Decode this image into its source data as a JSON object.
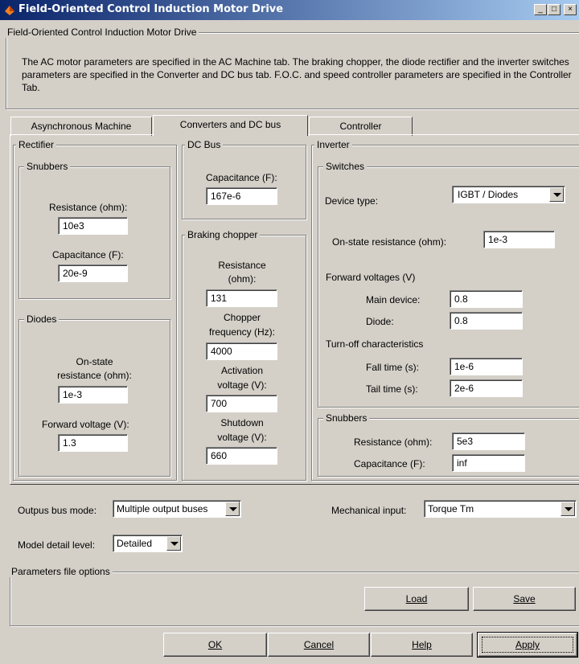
{
  "window": {
    "title": "Field-Oriented Control Induction Motor Drive",
    "btn_min": "_",
    "btn_max": "□",
    "btn_close": "×"
  },
  "header": {
    "group_title": "Field-Oriented Control Induction Motor Drive",
    "description": "The AC motor parameters are specified in the AC Machine tab. The braking chopper, the diode rectifier and the inverter switches parameters are specified in the Converter and DC bus tab. F.O.C. and speed controller parameters are specified in the Controller Tab."
  },
  "tabs": [
    {
      "label": "Asynchronous Machine"
    },
    {
      "label": "Converters and DC bus"
    },
    {
      "label": "Controller"
    }
  ],
  "rectifier": {
    "title": "Rectifier",
    "snubbers": {
      "title": "Snubbers",
      "resistance_label": "Resistance (ohm):",
      "resistance_value": "10e3",
      "capacitance_label": "Capacitance (F):",
      "capacitance_value": "20e-9"
    },
    "diodes": {
      "title": "Diodes",
      "onstate_label_1": "On-state",
      "onstate_label_2": "resistance (ohm):",
      "onstate_value": "1e-3",
      "fwd_label": "Forward voltage (V):",
      "fwd_value": "1.3"
    }
  },
  "dcbus": {
    "title": "DC Bus",
    "capacitance_label": "Capacitance (F):",
    "capacitance_value": "167e-6"
  },
  "chopper": {
    "title": "Braking chopper",
    "resistance_label_1": "Resistance",
    "resistance_label_2": "(ohm):",
    "resistance_value": "131",
    "freq_label_1": "Chopper",
    "freq_label_2": "frequency (Hz):",
    "freq_value": "4000",
    "act_label_1": "Activation",
    "act_label_2": "voltage (V):",
    "act_value": "700",
    "shut_label_1": "Shutdown",
    "shut_label_2": "voltage (V):",
    "shut_value": "660"
  },
  "inverter": {
    "title": "Inverter",
    "switches": {
      "title": "Switches",
      "device_label": "Device type:",
      "device_value": "IGBT / Diodes",
      "onstate_label": "On-state resistance (ohm):",
      "onstate_value": "1e-3",
      "fwd_title": "Forward voltages (V)",
      "main_label": "Main device:",
      "main_value": "0.8",
      "diode_label": "Diode:",
      "diode_value": "0.8",
      "turnoff_title": "Turn-off characteristics",
      "fall_label": "Fall time (s):",
      "fall_value": "1e-6",
      "tail_label": "Tail time (s):",
      "tail_value": "2e-6"
    },
    "snubbers": {
      "title": "Snubbers",
      "resistance_label": "Resistance (ohm):",
      "resistance_value": "5e3",
      "capacitance_label": "Capacitance (F):",
      "capacitance_value": "inf"
    }
  },
  "bottom": {
    "output_label": "Outpus bus mode:",
    "output_value": "Multiple output buses",
    "mech_label": "Mechanical input:",
    "mech_value": "Torque Tm",
    "detail_label": "Model detail level:",
    "detail_value": "Detailed",
    "params_title": "Parameters file options",
    "load": "Load",
    "save": "Save"
  },
  "buttons": {
    "ok": "OK",
    "cancel": "Cancel",
    "help": "Help",
    "apply": "Apply"
  }
}
